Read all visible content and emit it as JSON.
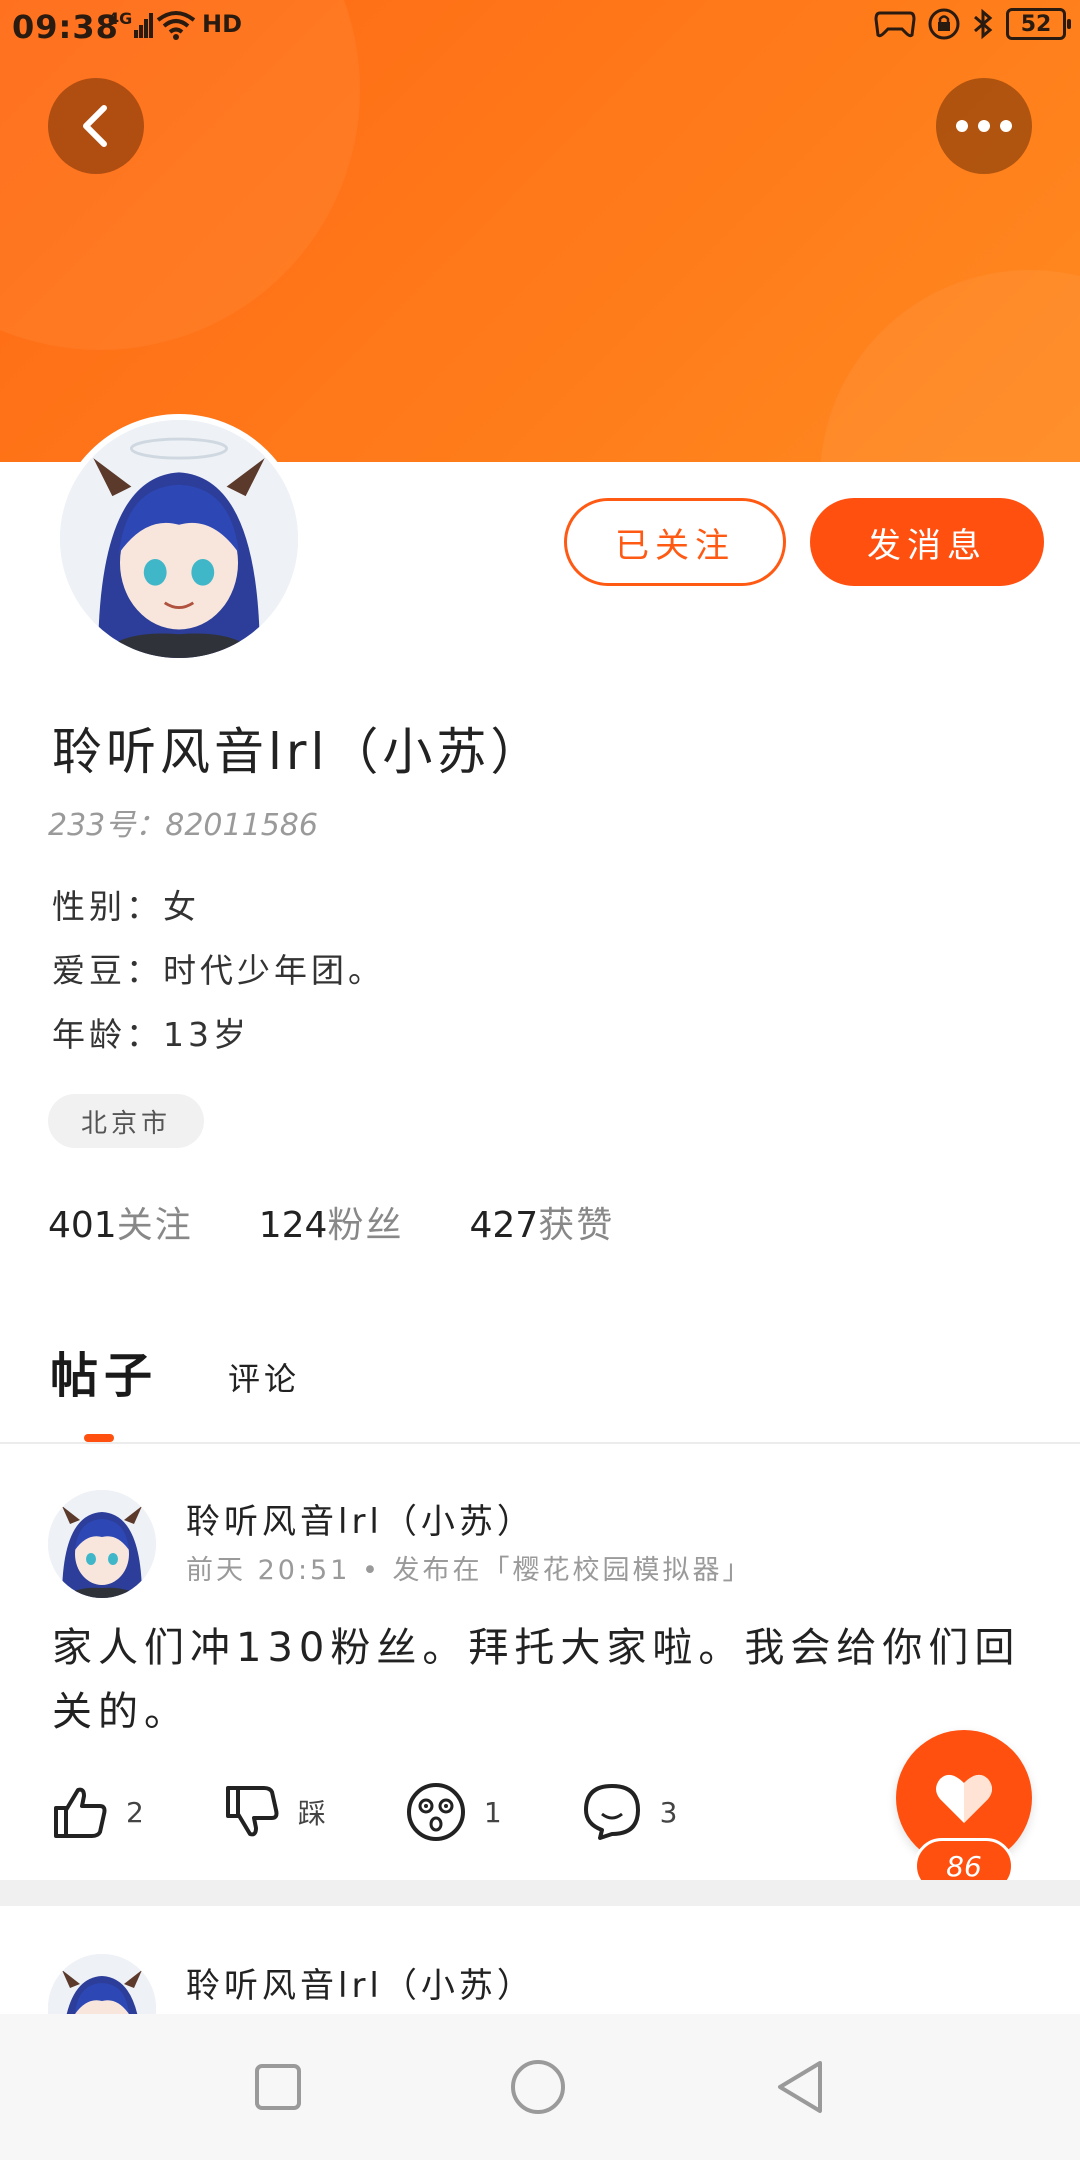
{
  "status_bar": {
    "time": "09:38",
    "network": "4G",
    "hd": "HD",
    "battery": "52"
  },
  "profile": {
    "follow_button": "已关注",
    "message_button": "发消息",
    "name": "聆听风音lrl（小苏）",
    "uid": "233号：82011586",
    "gender": "性别：女",
    "idol": "爱豆：时代少年团。",
    "age": "年龄：13岁",
    "city": "北京市",
    "stats": {
      "following_num": "401",
      "following_label": "关注",
      "fans_num": "124",
      "fans_label": "粉丝",
      "likes_num": "427",
      "likes_label": "获赞"
    }
  },
  "tabs": {
    "posts": "帖子",
    "comments": "评论"
  },
  "posts": [
    {
      "author": "聆听风音lrl（小苏）",
      "meta": "前天 20:51 • 发布在「樱花校园模拟器」",
      "body": "家人们冲130粉丝。拜托大家啦。我会给你们回关的。",
      "likes": "2",
      "dislike_label": "踩",
      "dizzy": "1",
      "comments": "3",
      "heart_count": "86"
    },
    {
      "author": "聆听风音lrl（小苏）"
    }
  ],
  "colors": {
    "accent": "#ff5010",
    "banner": "#ff7a1a"
  },
  "icons": [
    "back-icon",
    "more-icon",
    "thumb-up-icon",
    "thumb-down-icon",
    "dizzy-face-icon",
    "comment-icon",
    "heart-icon",
    "square-nav-icon",
    "circle-nav-icon",
    "triangle-back-nav-icon"
  ]
}
